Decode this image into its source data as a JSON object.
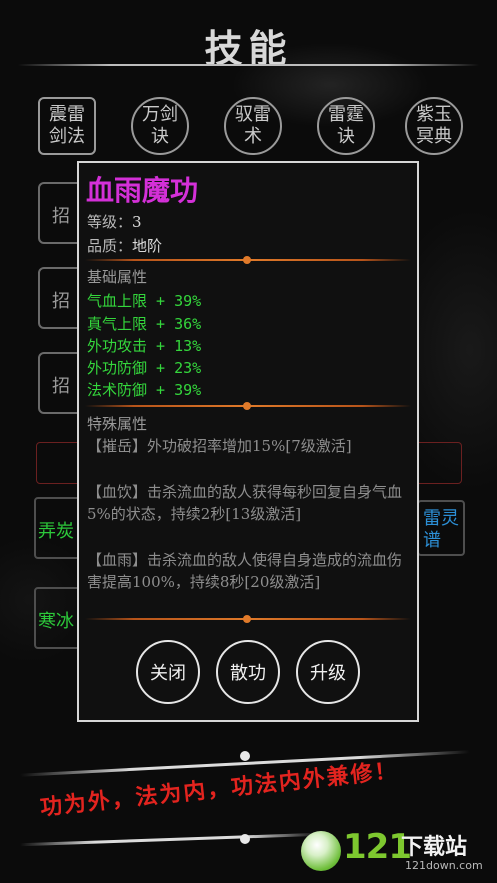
{
  "header": {
    "title": "技能"
  },
  "skill_tabs": [
    {
      "label": "震雷剑法"
    },
    {
      "label": "万剑诀"
    },
    {
      "label": "驭雷术"
    },
    {
      "label": "雷霆诀"
    },
    {
      "label": "紫玉冥典"
    }
  ],
  "background_slots": {
    "left": [
      "招",
      "招",
      "招"
    ],
    "left_green": [
      "弄炭",
      "寒冰"
    ],
    "right_blue": "雷灵谱"
  },
  "popup": {
    "skill_name": "血雨魔功",
    "level_label": "等级：",
    "level_value": "3",
    "quality_label": "品质：",
    "quality_value": "地阶",
    "base_section": "基础属性",
    "stats": [
      "气血上限 + 39%",
      "真气上限 + 36%",
      "外功攻击 + 13%",
      "外功防御 + 23%",
      "法术防御 + 39%"
    ],
    "special_section": "特殊属性",
    "specials": [
      "【摧岳】外功破招率增加15%[7级激活]",
      "【血饮】击杀流血的敌人获得每秒回复自身气血5%的状态，持续2秒[13级激活]",
      "【血雨】击杀流血的敌人使得自身造成的流血伤害提高100%，持续8秒[20级激活]"
    ],
    "buttons": {
      "close": "关闭",
      "disperse": "散功",
      "upgrade": "升级"
    }
  },
  "slogan": "功为外，法为内，功法内外兼修！",
  "logo": {
    "number": "121",
    "text": "下载站",
    "url": "121down.com"
  },
  "colors": {
    "skill_name": "#d430d8",
    "stat_green": "#34d63c",
    "divider_orange": "#e07a2a",
    "slogan_red": "#e3241f",
    "logo_green": "#7ec82f"
  }
}
